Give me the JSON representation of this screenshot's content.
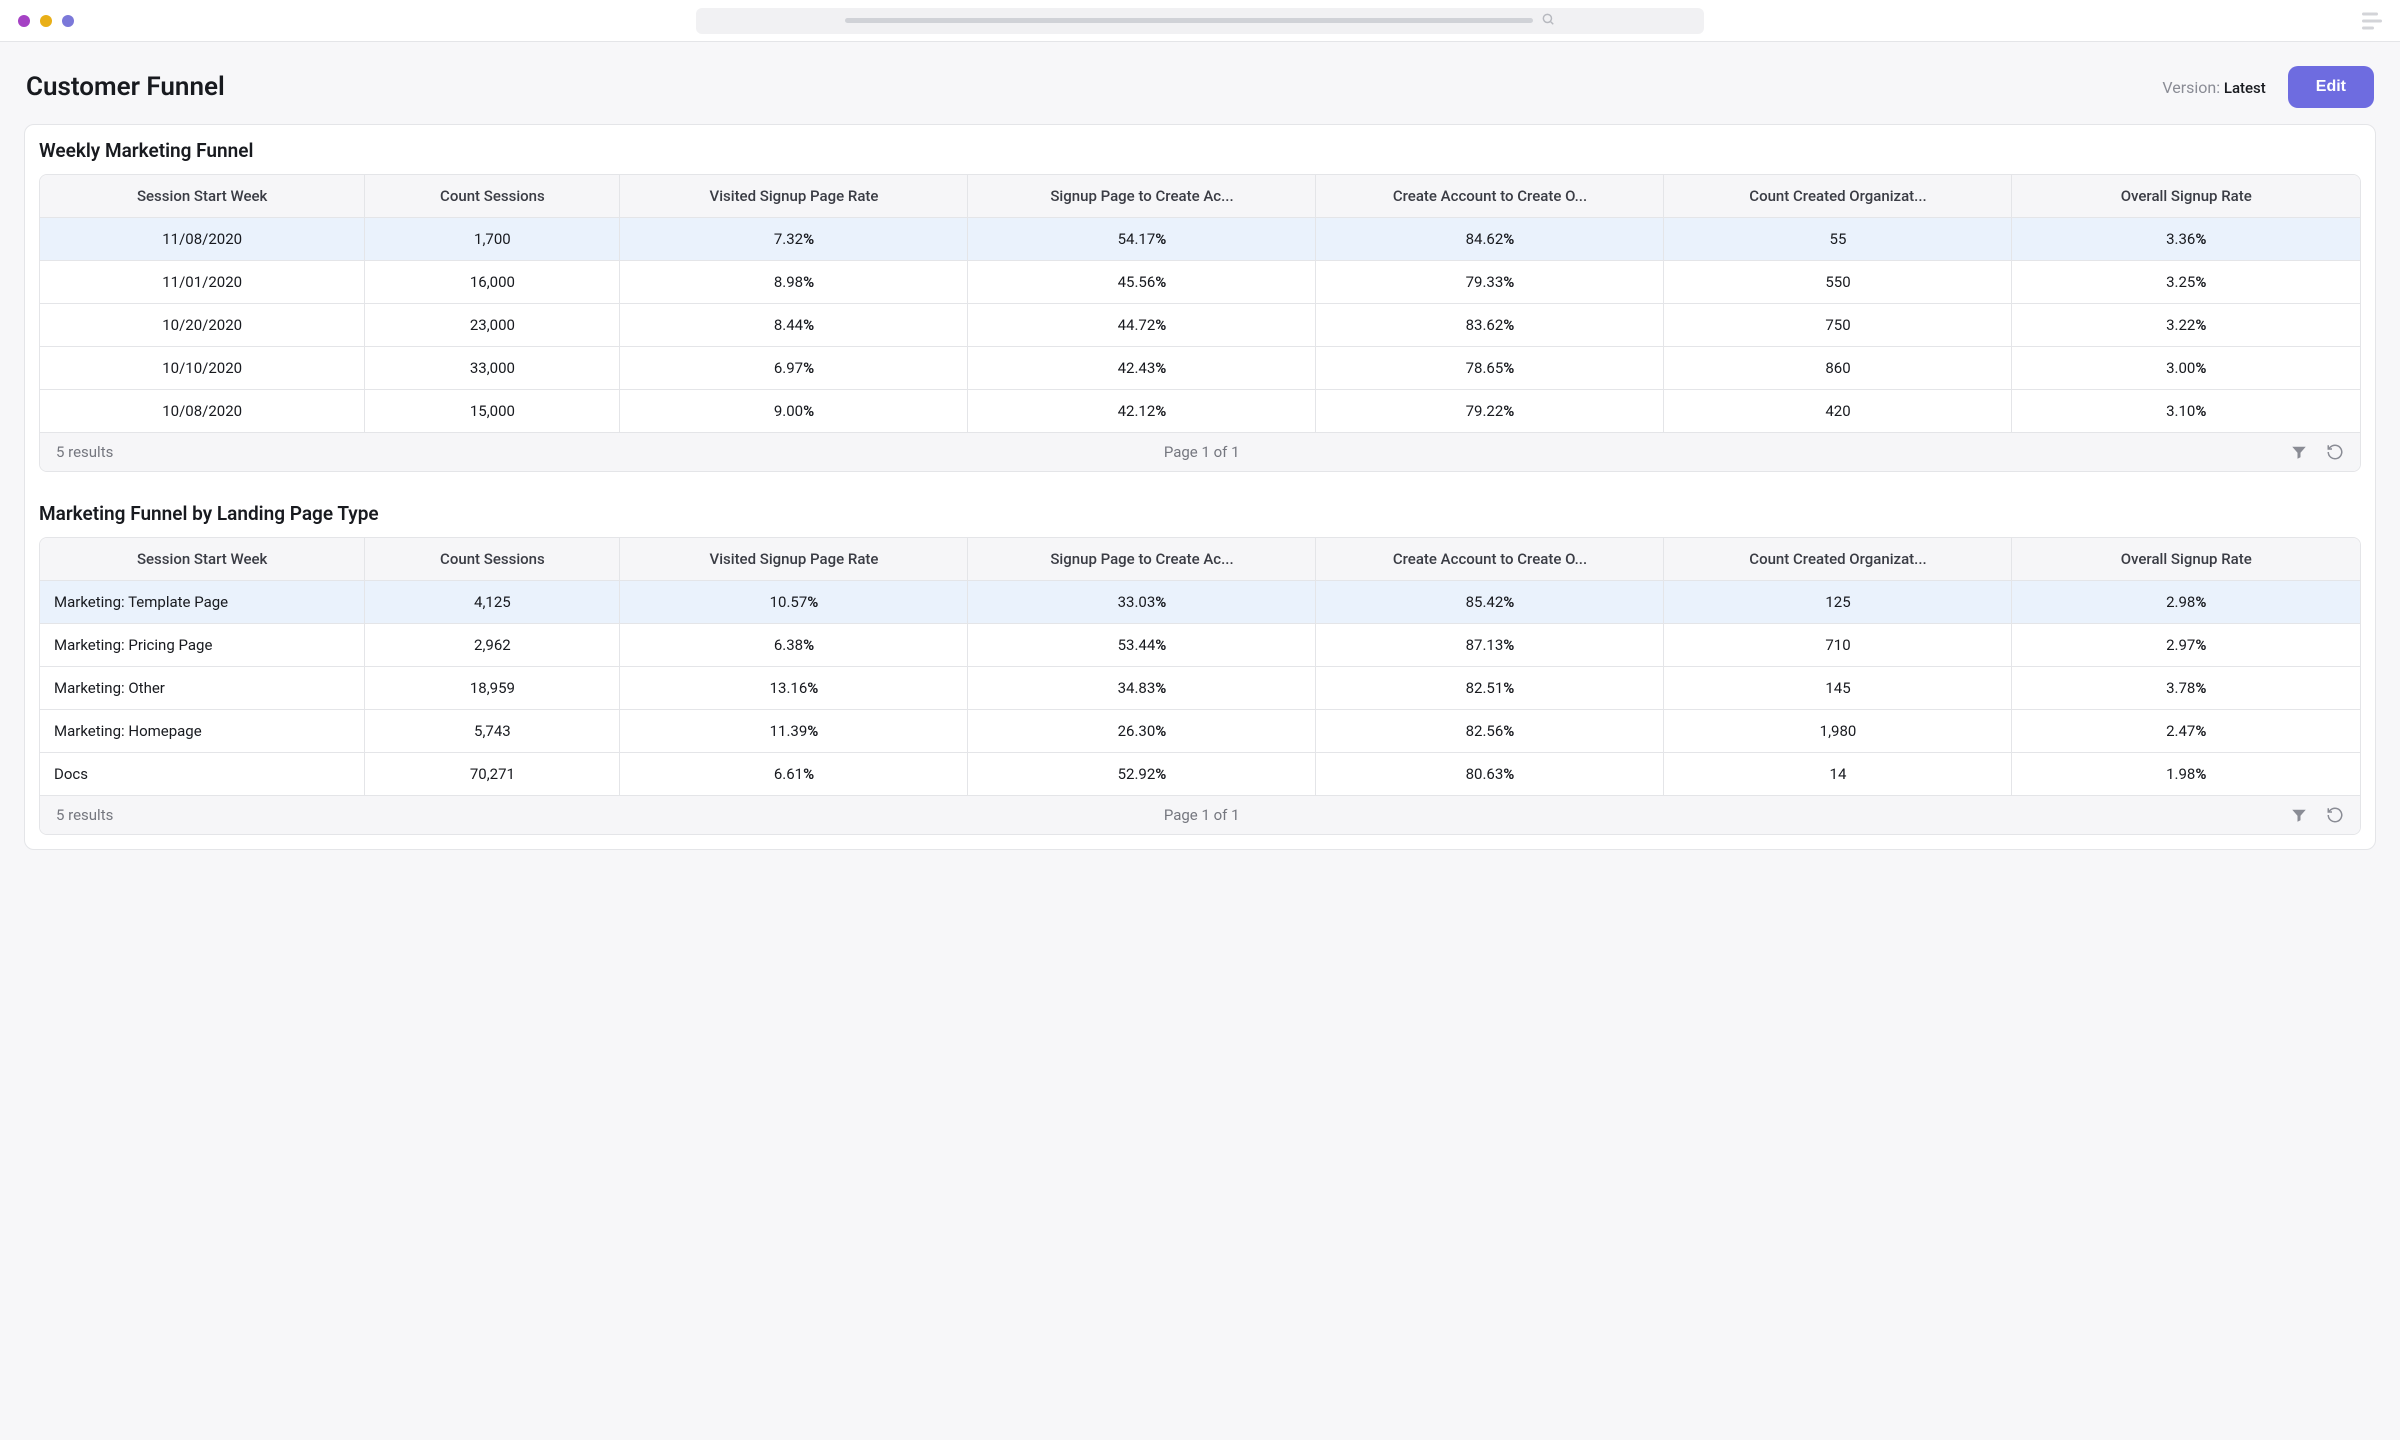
{
  "page": {
    "title": "Customer Funnel",
    "version_label": "Version:",
    "version_value": "Latest",
    "edit_label": "Edit"
  },
  "columns": [
    "Session Start Week",
    "Count Sessions",
    "Visited Signup Page Rate",
    "Signup Page to Create Account Rate",
    "Create Account to Create Organization Rate",
    "Count Created Organizations",
    "Overall Signup Rate"
  ],
  "sections": [
    {
      "title": "Weekly Marketing Funnel",
      "first_col_align": "center",
      "rows": [
        {
          "hl": true,
          "c0": "11/08/2020",
          "c1": "1,700",
          "c2": "7.32",
          "c3": "54.17",
          "c4": "84.62",
          "c5": "55",
          "c6": "3.36"
        },
        {
          "hl": false,
          "c0": "11/01/2020",
          "c1": "16,000",
          "c2": "8.98",
          "c3": "45.56",
          "c4": "79.33",
          "c5": "550",
          "c6": "3.25"
        },
        {
          "hl": false,
          "c0": "10/20/2020",
          "c1": "23,000",
          "c2": "8.44",
          "c3": "44.72",
          "c4": "83.62",
          "c5": "750",
          "c6": "3.22"
        },
        {
          "hl": false,
          "c0": "10/10/2020",
          "c1": "33,000",
          "c2": "6.97",
          "c3": "42.43",
          "c4": "78.65",
          "c5": "860",
          "c6": "3.00"
        },
        {
          "hl": false,
          "c0": "10/08/2020",
          "c1": "15,000",
          "c2": "9.00",
          "c3": "42.12",
          "c4": "79.22",
          "c5": "420",
          "c6": "3.10"
        }
      ],
      "footer": {
        "results": "5 results",
        "page": "Page 1 of 1"
      }
    },
    {
      "title": "Marketing Funnel by Landing Page Type",
      "first_col_align": "left",
      "rows": [
        {
          "hl": true,
          "c0": "Marketing: Template Page",
          "c1": "4,125",
          "c2": "10.57",
          "c3": "33.03",
          "c4": "85.42",
          "c5": "125",
          "c6": "2.98"
        },
        {
          "hl": false,
          "c0": "Marketing: Pricing Page",
          "c1": "2,962",
          "c2": "6.38",
          "c3": "53.44",
          "c4": "87.13",
          "c5": "710",
          "c6": "2.97"
        },
        {
          "hl": false,
          "c0": "Marketing: Other",
          "c1": "18,959",
          "c2": "13.16",
          "c3": "34.83",
          "c4": "82.51",
          "c5": "145",
          "c6": "3.78"
        },
        {
          "hl": false,
          "c0": "Marketing: Homepage",
          "c1": "5,743",
          "c2": "11.39",
          "c3": "26.30",
          "c4": "82.56",
          "c5": "1,980",
          "c6": "2.47"
        },
        {
          "hl": false,
          "c0": "Docs",
          "c1": "70,271",
          "c2": "6.61",
          "c3": "52.92",
          "c4": "80.63",
          "c5": "14",
          "c6": "1.98"
        }
      ],
      "footer": {
        "results": "5 results",
        "page": "Page 1 of 1"
      }
    }
  ]
}
